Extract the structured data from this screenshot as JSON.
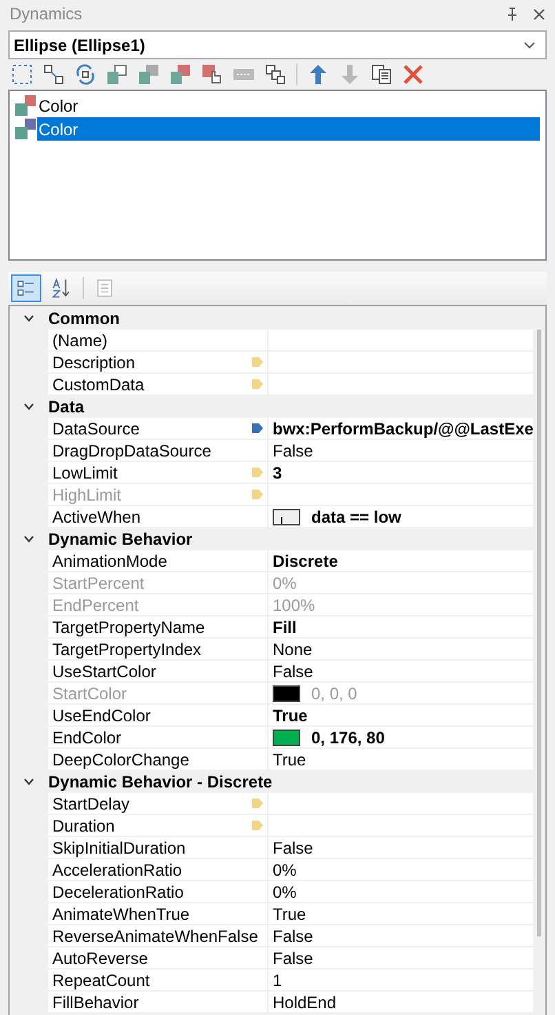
{
  "window": {
    "title": "Dynamics"
  },
  "object_selector": {
    "value": "Ellipse (Ellipse1)"
  },
  "dynamics_list": [
    {
      "label": "Color",
      "selected": false,
      "color": "#d46f6f"
    },
    {
      "label": "Color",
      "selected": true,
      "color": "#6a6fa8"
    }
  ],
  "property_toolbar": [
    {
      "kind": "categorized",
      "selected": true
    },
    {
      "kind": "alphabetical",
      "selected": false
    },
    {
      "kind": "pages",
      "selected": false
    }
  ],
  "property_grid": [
    {
      "kind": "category",
      "label": "Common",
      "expanded": true
    },
    {
      "kind": "property",
      "name": "(Name)",
      "disabled": false
    },
    {
      "kind": "property",
      "name": "Description",
      "disabled": false,
      "tag": {
        "color": "#f2d48a"
      }
    },
    {
      "kind": "property",
      "name": "CustomData",
      "disabled": false,
      "tag": {
        "color": "#f2d48a"
      }
    },
    {
      "kind": "category",
      "label": "Data",
      "expanded": true
    },
    {
      "kind": "property",
      "name": "DataSource",
      "value": "bwx:PerformBackup/@@LastExe",
      "disabled": false,
      "bold": true,
      "tag": {
        "color": "#3b6fb0"
      }
    },
    {
      "kind": "property",
      "name": "DragDropDataSource",
      "value": "False",
      "disabled": false,
      "bold": false
    },
    {
      "kind": "property",
      "name": "LowLimit",
      "value": "3",
      "disabled": false,
      "bold": true,
      "tag": {
        "color": "#f2d48a"
      }
    },
    {
      "kind": "property",
      "name": "HighLimit",
      "disabled": true,
      "tag": {
        "color": "#f2d48a"
      }
    },
    {
      "kind": "condition",
      "name": "ActiveWhen",
      "value": "data == low",
      "disabled": false,
      "bold": true
    },
    {
      "kind": "category",
      "label": "Dynamic Behavior",
      "expanded": true
    },
    {
      "kind": "property",
      "name": "AnimationMode",
      "value": "Discrete",
      "disabled": false,
      "bold": true
    },
    {
      "kind": "property",
      "name": "StartPercent",
      "value": "0%",
      "disabled": true,
      "bold": false
    },
    {
      "kind": "property",
      "name": "EndPercent",
      "value": "100%",
      "disabled": true,
      "bold": false
    },
    {
      "kind": "property",
      "name": "TargetPropertyName",
      "value": "Fill",
      "disabled": false,
      "bold": true
    },
    {
      "kind": "property",
      "name": "TargetPropertyIndex",
      "value": "None",
      "disabled": false,
      "bold": false
    },
    {
      "kind": "property",
      "name": "UseStartColor",
      "value": "False",
      "disabled": false,
      "bold": false
    },
    {
      "kind": "color",
      "name": "StartColor",
      "value": "0, 0, 0",
      "color": "#000000",
      "disabled": true,
      "bold": false
    },
    {
      "kind": "property",
      "name": "UseEndColor",
      "value": "True",
      "disabled": false,
      "bold": true
    },
    {
      "kind": "color",
      "name": "EndColor",
      "value": "0, 176, 80",
      "color": "#00b050",
      "disabled": false,
      "bold": true
    },
    {
      "kind": "property",
      "name": "DeepColorChange",
      "value": "True",
      "disabled": false,
      "bold": false
    },
    {
      "kind": "category",
      "label": "Dynamic Behavior - Discrete",
      "expanded": true
    },
    {
      "kind": "property",
      "name": "StartDelay",
      "disabled": false,
      "tag": {
        "color": "#f2d48a"
      }
    },
    {
      "kind": "property",
      "name": "Duration",
      "disabled": false,
      "tag": {
        "color": "#f2d48a"
      }
    },
    {
      "kind": "property",
      "name": "SkipInitialDuration",
      "value": "False",
      "disabled": false,
      "bold": false
    },
    {
      "kind": "property",
      "name": "AccelerationRatio",
      "value": "0%",
      "disabled": false,
      "bold": false
    },
    {
      "kind": "property",
      "name": "DecelerationRatio",
      "value": "0%",
      "disabled": false,
      "bold": false
    },
    {
      "kind": "property",
      "name": "AnimateWhenTrue",
      "value": "True",
      "disabled": false,
      "bold": false
    },
    {
      "kind": "property",
      "name": "ReverseAnimateWhenFalse",
      "value": "False",
      "disabled": false,
      "bold": false
    },
    {
      "kind": "property",
      "name": "AutoReverse",
      "value": "False",
      "disabled": false,
      "bold": false
    },
    {
      "kind": "property",
      "name": "RepeatCount",
      "value": "1",
      "disabled": false,
      "bold": false
    },
    {
      "kind": "property",
      "name": "FillBehavior",
      "value": "HoldEnd",
      "disabled": false,
      "bold": false
    }
  ]
}
